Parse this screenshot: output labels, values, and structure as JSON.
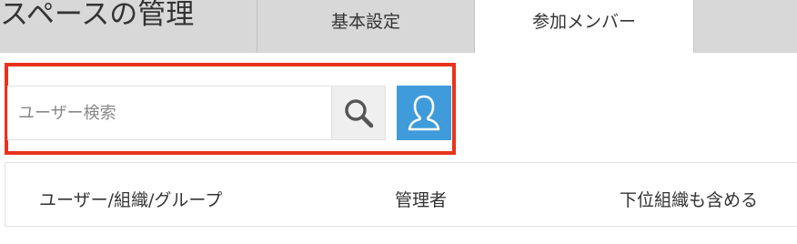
{
  "header": {
    "title": "スペースの管理",
    "tabs": [
      {
        "label": "基本設定",
        "active": false
      },
      {
        "label": "参加メンバー",
        "active": true
      }
    ]
  },
  "search": {
    "placeholder": "ユーザー検索",
    "value": ""
  },
  "icons": {
    "search": "search-icon",
    "user_picker": "user-icon"
  },
  "colors": {
    "highlight_border": "#e8331c",
    "user_button": "#3f9bd9",
    "topbar": "#d8d8d8"
  },
  "table": {
    "columns": [
      "ユーザー/組織/グループ",
      "管理者",
      "下位組織も含める"
    ]
  }
}
